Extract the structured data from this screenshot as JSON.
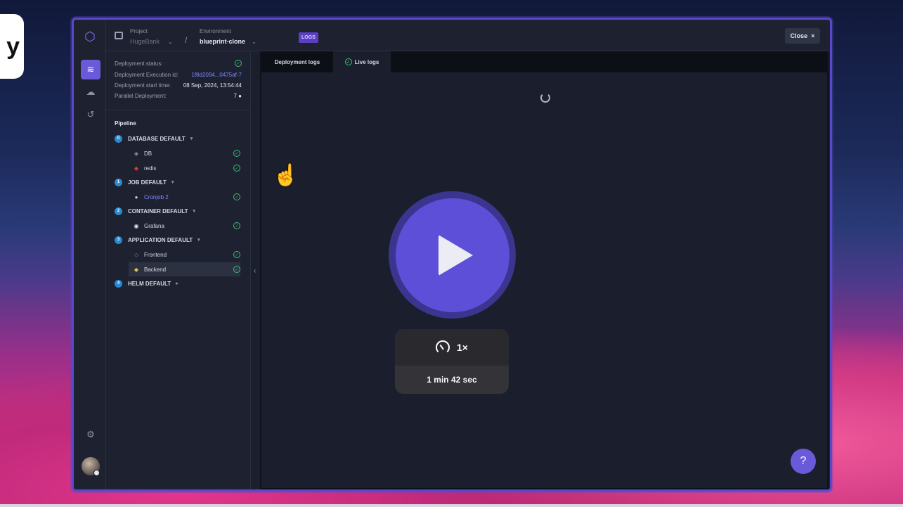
{
  "corner_tab": {
    "text": "y"
  },
  "topbar": {
    "project_label": "Project",
    "project_value": "HugeBank",
    "separator": "/",
    "environment_label": "Environment",
    "environment_value": "blueprint-clone",
    "logs_badge": "LOGS",
    "close_label": "Close",
    "close_icon": "×"
  },
  "deployment": {
    "status_label": "Deployment status:",
    "execution_id_label": "Deployment Execution id:",
    "execution_id_value": "1f8d2094...0475af-7",
    "start_time_label": "Deployment start time:",
    "start_time_value": "08 Sep, 2024, 13:54:44",
    "parallel_label": "Parallel Deployment:",
    "parallel_value": "7"
  },
  "pipeline": {
    "title": "Pipeline",
    "groups": [
      {
        "num": "0",
        "name": "DATABASE DEFAULT",
        "caret": "▾"
      },
      {
        "num": "1",
        "name": "JOB DEFAULT",
        "caret": "▾"
      },
      {
        "num": "2",
        "name": "CONTAINER DEFAULT",
        "caret": "▾"
      },
      {
        "num": "3",
        "name": "APPLICATION DEFAULT",
        "caret": "▾"
      },
      {
        "num": "4",
        "name": "HELM DEFAULT",
        "caret": "▸"
      }
    ],
    "services": [
      {
        "name": "DB",
        "icon": "postgres-icon"
      },
      {
        "name": "redis",
        "icon": "redis-icon"
      },
      {
        "name": "Cronjob 2",
        "icon": "cronjob-icon"
      },
      {
        "name": "Grafana",
        "icon": "grafana-icon"
      },
      {
        "name": "Frontend",
        "icon": "frontend-icon"
      },
      {
        "name": "Backend",
        "icon": "python-icon"
      }
    ]
  },
  "tabs": [
    {
      "label": "Deployment logs"
    },
    {
      "label": "Live logs"
    }
  ],
  "help": {
    "label": "?"
  },
  "player": {
    "speed": "1×",
    "duration": "1 min 42 sec"
  },
  "colors": {
    "accent": "#6a5ad9",
    "success": "#39c07a",
    "badge": "#5a3fc4",
    "group_num": "#2a8ad0"
  }
}
